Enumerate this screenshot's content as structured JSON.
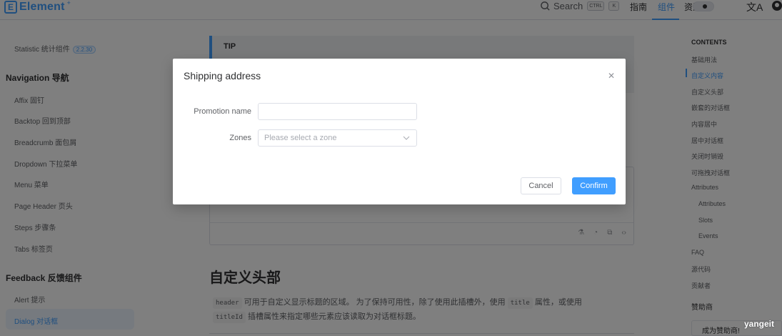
{
  "navbar": {
    "logo_text": "Element",
    "logo_sup": "+",
    "search_label": "Search",
    "kbd_ctrl": "CTRL",
    "kbd_k": "K",
    "links": [
      "指南",
      "组件",
      "资源"
    ],
    "lang_icon": "translate-icon",
    "github_icon": "github-icon"
  },
  "sidebar": {
    "statistic_label": "Statistic 统计组件",
    "statistic_badge": "2.2.30",
    "nav_group": "Navigation 导航",
    "nav_items": [
      "Affix 固钉",
      "Backtop 回到顶部",
      "Breadcrumb 面包屑",
      "Dropdown 下拉菜单",
      "Menu 菜单",
      "Page Header 页头",
      "Steps 步骤条",
      "Tabs 标签页"
    ],
    "feedback_group": "Feedback 反馈组件",
    "feedback_items": [
      "Alert 提示",
      "Dialog 对话框"
    ]
  },
  "main": {
    "tip_title": "TIP",
    "section_heading": "自定义头部",
    "para_code_header": "header",
    "para_text_1": "可用于自定义显示标题的区域。 为了保持可用性，除了使用此插槽外，使用",
    "para_code_title": "title",
    "para_text_2": "属性，或使用",
    "para_code_titleid": "titleId",
    "para_text_3": "插槽属性来指定哪些元素应该读取为对话框标题。"
  },
  "toc": {
    "title": "CONTENTS",
    "items": [
      "基础用法",
      "自定义内容",
      "自定义头部",
      "嵌套的对话框",
      "内容居中",
      "居中对话框",
      "关闭时销毁",
      "可拖拽对话框",
      "Attributes"
    ],
    "sub_items": [
      "Attributes",
      "Slots",
      "Events"
    ],
    "tail_items": [
      "FAQ",
      "源代码",
      "贡献者"
    ],
    "sponsor_label": "赞助商",
    "sponsor_box": "成为赞助商!",
    "watermark": "yangeit"
  },
  "dialog": {
    "title": "Shipping address",
    "promotion_label": "Promotion name",
    "promotion_value": "",
    "zones_label": "Zones",
    "zones_placeholder": "Please select a zone",
    "cancel_label": "Cancel",
    "confirm_label": "Confirm"
  },
  "colors": {
    "accent": "#409eff",
    "overlay": "rgba(0,0,0,0.5)"
  }
}
